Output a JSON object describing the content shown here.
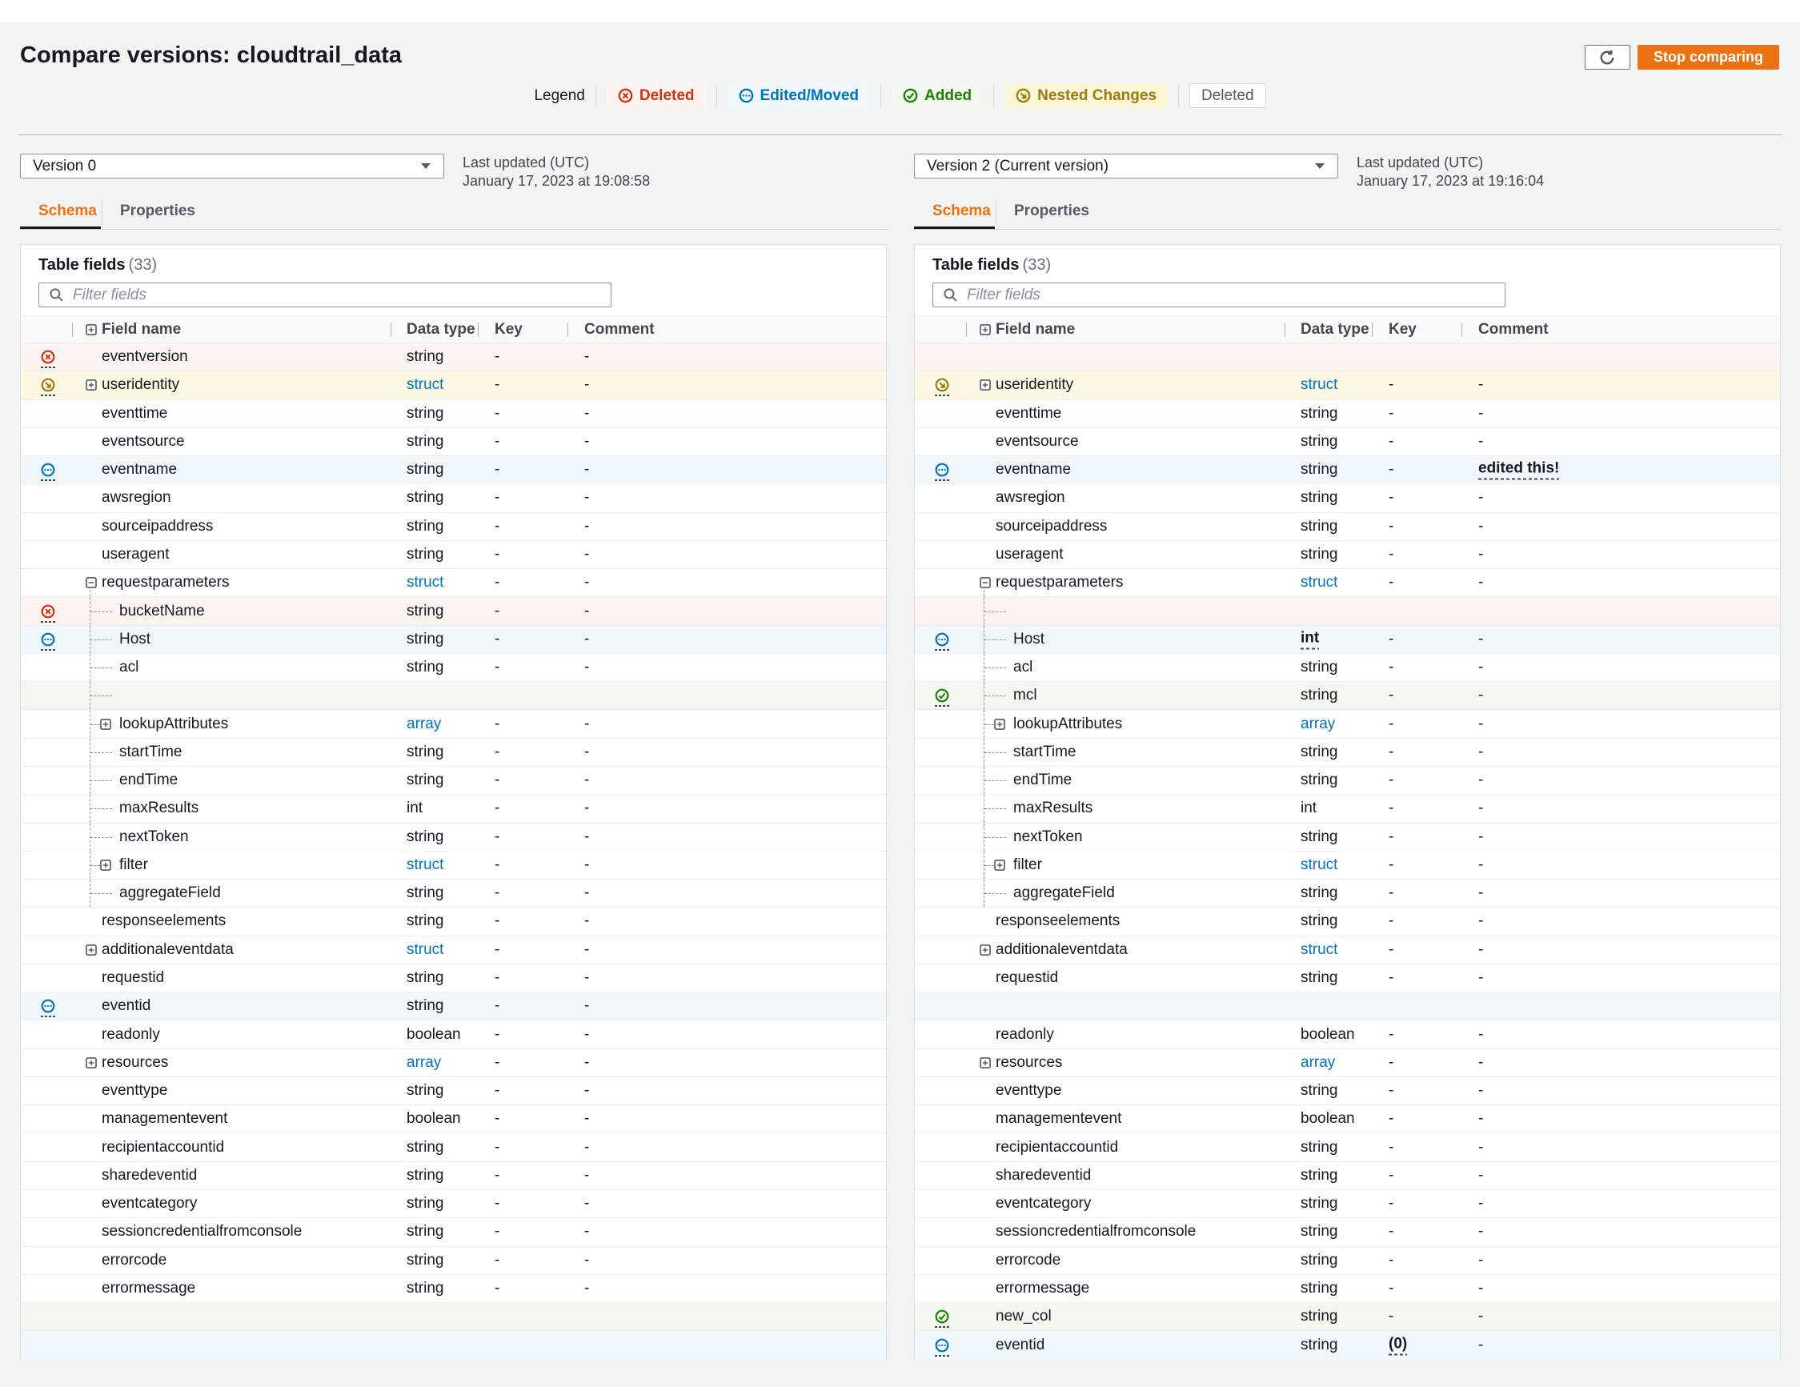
{
  "page": {
    "title": "Compare versions: cloudtrail_data",
    "stop_button": "Stop comparing"
  },
  "colors": {
    "accent": "#ec7211",
    "deleted": "#d13212",
    "edited": "#0073bb",
    "added": "#1d8102",
    "nested": "#9c7b10"
  },
  "legend": {
    "label": "Legend",
    "items": [
      {
        "label": "Deleted",
        "type": "deleted",
        "icon": "circle-x-icon"
      },
      {
        "label": "Edited/Moved",
        "type": "edited",
        "icon": "circle-ellipsis-icon"
      },
      {
        "label": "Added",
        "type": "added",
        "icon": "circle-check-icon"
      },
      {
        "label": "Nested Changes",
        "type": "nested",
        "icon": "circle-arrow-nested-icon"
      },
      {
        "label": "Deleted",
        "type": "plain",
        "icon": ""
      }
    ]
  },
  "panels": [
    {
      "version_label": "Version 0",
      "last_updated_label": "Last updated (UTC)",
      "last_updated_value": "January 17, 2023 at 19:08:58",
      "tabs": [
        "Schema",
        "Properties"
      ],
      "active_tab": "Schema",
      "table_title": "Table fields",
      "table_count": "(33)",
      "filter_placeholder": "Filter fields",
      "columns": [
        "Field name",
        "Data type",
        "Key",
        "Comment"
      ],
      "rows": [
        {
          "name": "eventversion",
          "dtype": "string",
          "key": "-",
          "comment": "-",
          "status": "deleted",
          "bg": "red"
        },
        {
          "name": "useridentity",
          "dtype": "struct",
          "key": "-",
          "comment": "-",
          "status": "nested",
          "bg": "yellow",
          "expand": "plus",
          "dtype_style": "link"
        },
        {
          "name": "eventtime",
          "dtype": "string",
          "key": "-",
          "comment": "-"
        },
        {
          "name": "eventsource",
          "dtype": "string",
          "key": "-",
          "comment": "-"
        },
        {
          "name": "eventname",
          "dtype": "string",
          "key": "-",
          "comment": "-",
          "status": "edited",
          "bg": "blue"
        },
        {
          "name": "awsregion",
          "dtype": "string",
          "key": "-",
          "comment": "-"
        },
        {
          "name": "sourceipaddress",
          "dtype": "string",
          "key": "-",
          "comment": "-"
        },
        {
          "name": "useragent",
          "dtype": "string",
          "key": "-",
          "comment": "-"
        },
        {
          "name": "requestparameters",
          "dtype": "struct",
          "key": "-",
          "comment": "-",
          "expand": "minus",
          "dtype_style": "link"
        },
        {
          "name": "bucketName",
          "dtype": "string",
          "key": "-",
          "comment": "-",
          "level": 1,
          "status": "deleted",
          "bg": "red"
        },
        {
          "name": "Host",
          "dtype": "string",
          "key": "-",
          "comment": "-",
          "level": 1,
          "status": "edited",
          "bg": "blue"
        },
        {
          "name": "acl",
          "dtype": "string",
          "key": "-",
          "comment": "-",
          "level": 1
        },
        {
          "name": "",
          "level": 1,
          "bg": "green"
        },
        {
          "name": "lookupAttributes",
          "dtype": "array",
          "key": "-",
          "comment": "-",
          "level": 1,
          "expand": "plus",
          "dtype_style": "link"
        },
        {
          "name": "startTime",
          "dtype": "string",
          "key": "-",
          "comment": "-",
          "level": 1
        },
        {
          "name": "endTime",
          "dtype": "string",
          "key": "-",
          "comment": "-",
          "level": 1
        },
        {
          "name": "maxResults",
          "dtype": "int",
          "key": "-",
          "comment": "-",
          "level": 1
        },
        {
          "name": "nextToken",
          "dtype": "string",
          "key": "-",
          "comment": "-",
          "level": 1
        },
        {
          "name": "filter",
          "dtype": "struct",
          "key": "-",
          "comment": "-",
          "level": 1,
          "expand": "plus",
          "dtype_style": "link"
        },
        {
          "name": "aggregateField",
          "dtype": "string",
          "key": "-",
          "comment": "-",
          "level": 1
        },
        {
          "name": "responseelements",
          "dtype": "string",
          "key": "-",
          "comment": "-"
        },
        {
          "name": "additionaleventdata",
          "dtype": "struct",
          "key": "-",
          "comment": "-",
          "expand": "plus",
          "dtype_style": "link"
        },
        {
          "name": "requestid",
          "dtype": "string",
          "key": "-",
          "comment": "-"
        },
        {
          "name": "eventid",
          "dtype": "string",
          "key": "-",
          "comment": "-",
          "status": "edited",
          "bg": "blue"
        },
        {
          "name": "readonly",
          "dtype": "boolean",
          "key": "-",
          "comment": "-"
        },
        {
          "name": "resources",
          "dtype": "array",
          "key": "-",
          "comment": "-",
          "expand": "plus",
          "dtype_style": "link"
        },
        {
          "name": "eventtype",
          "dtype": "string",
          "key": "-",
          "comment": "-"
        },
        {
          "name": "managementevent",
          "dtype": "boolean",
          "key": "-",
          "comment": "-"
        },
        {
          "name": "recipientaccountid",
          "dtype": "string",
          "key": "-",
          "comment": "-"
        },
        {
          "name": "sharedeventid",
          "dtype": "string",
          "key": "-",
          "comment": "-"
        },
        {
          "name": "eventcategory",
          "dtype": "string",
          "key": "-",
          "comment": "-"
        },
        {
          "name": "sessioncredentialfromconsole",
          "dtype": "string",
          "key": "-",
          "comment": "-"
        },
        {
          "name": "errorcode",
          "dtype": "string",
          "key": "-",
          "comment": "-"
        },
        {
          "name": "errormessage",
          "dtype": "string",
          "key": "-",
          "comment": "-"
        },
        {
          "name": "",
          "bg": "green"
        },
        {
          "name": "",
          "bg": "blue"
        }
      ]
    },
    {
      "version_label": "Version 2 (Current version)",
      "last_updated_label": "Last updated (UTC)",
      "last_updated_value": "January 17, 2023 at 19:16:04",
      "tabs": [
        "Schema",
        "Properties"
      ],
      "active_tab": "Schema",
      "table_title": "Table fields",
      "table_count": "(33)",
      "filter_placeholder": "Filter fields",
      "columns": [
        "Field name",
        "Data type",
        "Key",
        "Comment"
      ],
      "rows": [
        {
          "name": "",
          "bg": "red"
        },
        {
          "name": "useridentity",
          "dtype": "struct",
          "key": "-",
          "comment": "-",
          "status": "nested",
          "bg": "yellow",
          "expand": "plus",
          "dtype_style": "link"
        },
        {
          "name": "eventtime",
          "dtype": "string",
          "key": "-",
          "comment": "-"
        },
        {
          "name": "eventsource",
          "dtype": "string",
          "key": "-",
          "comment": "-"
        },
        {
          "name": "eventname",
          "dtype": "string",
          "key": "-",
          "comment": "edited this!",
          "status": "edited",
          "bg": "blue",
          "comment_style": "changed"
        },
        {
          "name": "awsregion",
          "dtype": "string",
          "key": "-",
          "comment": "-"
        },
        {
          "name": "sourceipaddress",
          "dtype": "string",
          "key": "-",
          "comment": "-"
        },
        {
          "name": "useragent",
          "dtype": "string",
          "key": "-",
          "comment": "-"
        },
        {
          "name": "requestparameters",
          "dtype": "struct",
          "key": "-",
          "comment": "-",
          "expand": "minus",
          "dtype_style": "link"
        },
        {
          "name": "",
          "level": 1,
          "bg": "red"
        },
        {
          "name": "Host",
          "dtype": "int",
          "key": "-",
          "comment": "-",
          "level": 1,
          "status": "edited",
          "bg": "blue",
          "dtype_style": "changed"
        },
        {
          "name": "acl",
          "dtype": "string",
          "key": "-",
          "comment": "-",
          "level": 1
        },
        {
          "name": "mcl",
          "dtype": "string",
          "key": "-",
          "comment": "-",
          "level": 1,
          "status": "added",
          "bg": "green"
        },
        {
          "name": "lookupAttributes",
          "dtype": "array",
          "key": "-",
          "comment": "-",
          "level": 1,
          "expand": "plus",
          "dtype_style": "link"
        },
        {
          "name": "startTime",
          "dtype": "string",
          "key": "-",
          "comment": "-",
          "level": 1
        },
        {
          "name": "endTime",
          "dtype": "string",
          "key": "-",
          "comment": "-",
          "level": 1
        },
        {
          "name": "maxResults",
          "dtype": "int",
          "key": "-",
          "comment": "-",
          "level": 1
        },
        {
          "name": "nextToken",
          "dtype": "string",
          "key": "-",
          "comment": "-",
          "level": 1
        },
        {
          "name": "filter",
          "dtype": "struct",
          "key": "-",
          "comment": "-",
          "level": 1,
          "expand": "plus",
          "dtype_style": "link"
        },
        {
          "name": "aggregateField",
          "dtype": "string",
          "key": "-",
          "comment": "-",
          "level": 1
        },
        {
          "name": "responseelements",
          "dtype": "string",
          "key": "-",
          "comment": "-"
        },
        {
          "name": "additionaleventdata",
          "dtype": "struct",
          "key": "-",
          "comment": "-",
          "expand": "plus",
          "dtype_style": "link"
        },
        {
          "name": "requestid",
          "dtype": "string",
          "key": "-",
          "comment": "-"
        },
        {
          "name": "",
          "bg": "blue"
        },
        {
          "name": "readonly",
          "dtype": "boolean",
          "key": "-",
          "comment": "-"
        },
        {
          "name": "resources",
          "dtype": "array",
          "key": "-",
          "comment": "-",
          "expand": "plus",
          "dtype_style": "link"
        },
        {
          "name": "eventtype",
          "dtype": "string",
          "key": "-",
          "comment": "-"
        },
        {
          "name": "managementevent",
          "dtype": "boolean",
          "key": "-",
          "comment": "-"
        },
        {
          "name": "recipientaccountid",
          "dtype": "string",
          "key": "-",
          "comment": "-"
        },
        {
          "name": "sharedeventid",
          "dtype": "string",
          "key": "-",
          "comment": "-"
        },
        {
          "name": "eventcategory",
          "dtype": "string",
          "key": "-",
          "comment": "-"
        },
        {
          "name": "sessioncredentialfromconsole",
          "dtype": "string",
          "key": "-",
          "comment": "-"
        },
        {
          "name": "errorcode",
          "dtype": "string",
          "key": "-",
          "comment": "-"
        },
        {
          "name": "errormessage",
          "dtype": "string",
          "key": "-",
          "comment": "-"
        },
        {
          "name": "new_col",
          "dtype": "string",
          "key": "-",
          "comment": "-",
          "status": "added",
          "bg": "green"
        },
        {
          "name": "eventid",
          "dtype": "string",
          "key": "(0)",
          "comment": "-",
          "status": "edited",
          "bg": "blue",
          "key_style": "changed"
        }
      ]
    }
  ]
}
